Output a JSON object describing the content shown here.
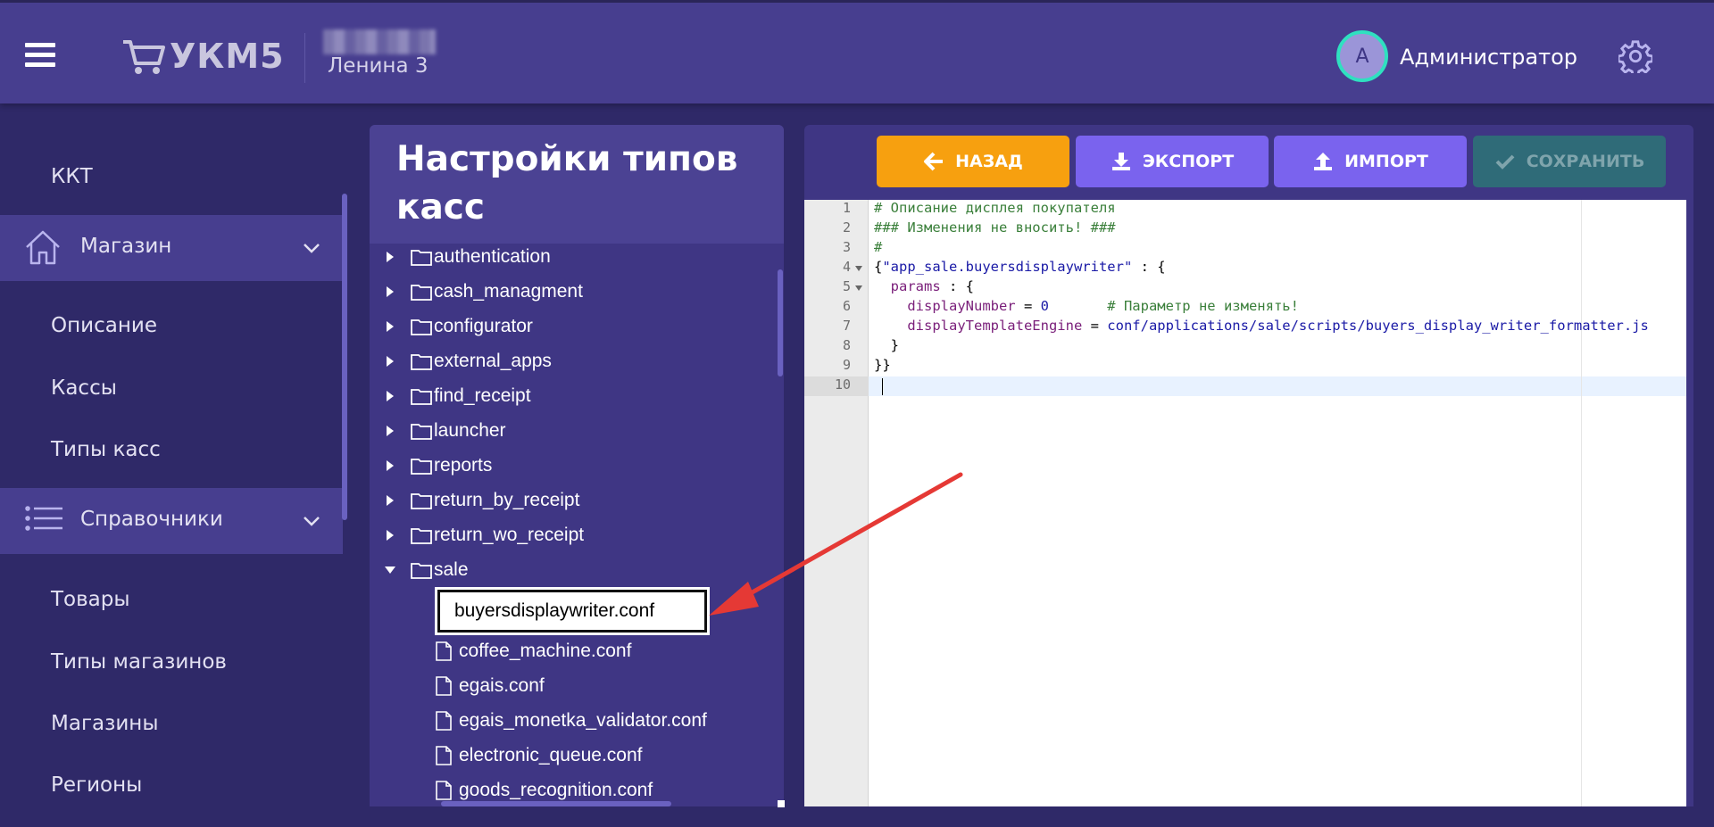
{
  "header": {
    "logo_text": "УКМ5",
    "store_name": "Ленина 3",
    "avatar_letter": "А",
    "user_name": "Администратор"
  },
  "sidebar": {
    "kkt": "ККТ",
    "store_group": "Магазин",
    "store_items": [
      "Описание",
      "Кассы",
      "Типы касс"
    ],
    "ref_group": "Справочники",
    "ref_items": [
      "Товары",
      "Типы магазинов",
      "Магазины",
      "Регионы"
    ]
  },
  "tree": {
    "title": "Настройки типов касс",
    "folders": [
      "authentication",
      "cash_managment",
      "configurator",
      "external_apps",
      "find_receipt",
      "launcher",
      "reports",
      "return_by_receipt",
      "return_wo_receipt",
      "sale"
    ],
    "rename_value": "buyersdisplaywriter.conf",
    "files": [
      "coffee_machine.conf",
      "egais.conf",
      "egais_monetka_validator.conf",
      "electronic_queue.conf",
      "goods_recognition.conf"
    ]
  },
  "toolbar": {
    "back": "НАЗАД",
    "export": "ЭКСПОРТ",
    "import": "ИМПОРТ",
    "save": "СОХРАНИТЬ"
  },
  "editor": {
    "line_numbers": [
      "1",
      "2",
      "3",
      "4",
      "5",
      "6",
      "7",
      "8",
      "9",
      "10"
    ],
    "l1": "# Описание дисплея покупателя",
    "l2": "### Изменения не вносить! ###",
    "l3": "#",
    "l4_open": "{",
    "l4_str": "\"app_sale.buyersdisplaywriter\"",
    "l4_rest": " : {",
    "l5_key": "  params",
    "l5_rest": " : {",
    "l6_key": "    displayNumber",
    "l6_eq": " = ",
    "l6_val": "0",
    "l6_comment": "       # Параметр не изменять!",
    "l7_key": "    displayTemplateEngine",
    "l7_eq": " = ",
    "l7_val": "conf/applications/sale/scripts/buyers_display_writer_formatter.js",
    "l8": "  }",
    "l9": "}}",
    "l10": ""
  },
  "colors": {
    "header_bg": "#473e8f",
    "page_bg": "#2f2968",
    "back_btn": "#f7a00f",
    "action_btn": "#7a63ee",
    "save_btn_disabled": "#2f6b78",
    "avatar_ring": "#2fe0c0",
    "annotation_arrow": "#e53935"
  }
}
